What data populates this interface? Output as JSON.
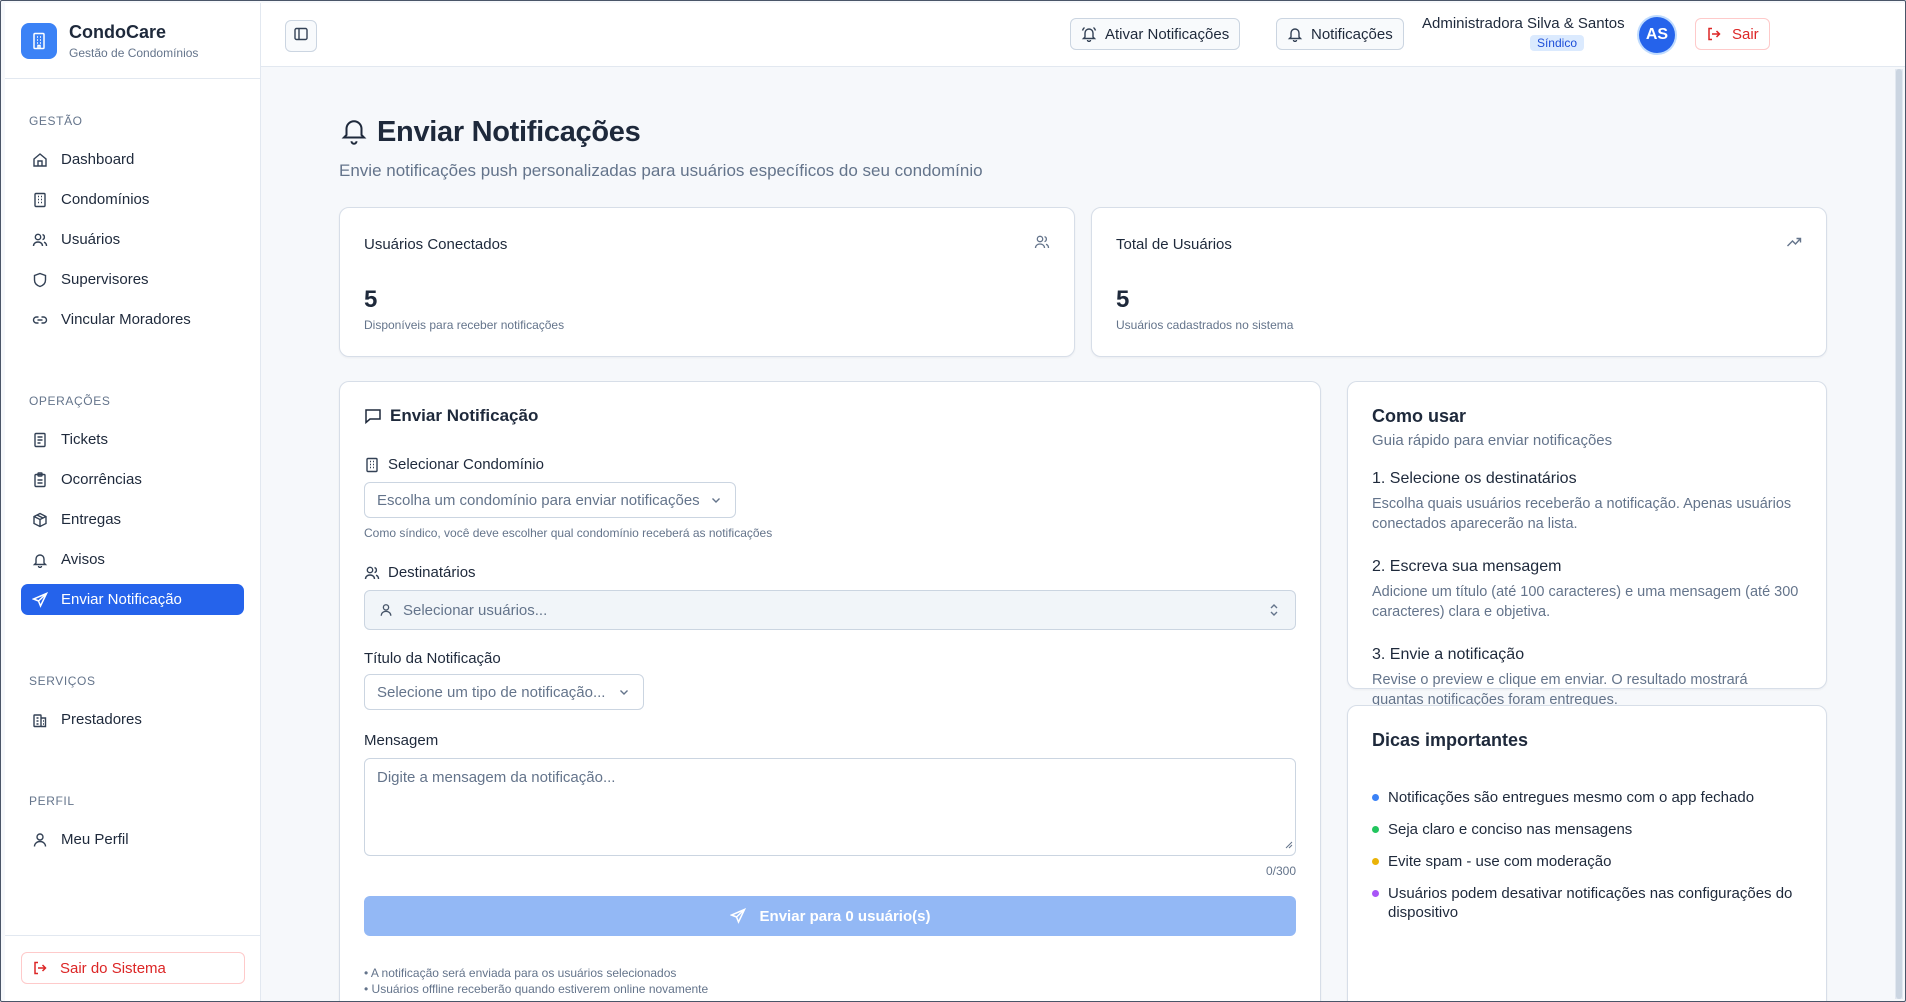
{
  "app": {
    "name": "CondoCare",
    "subtitle": "Gestão de Condomínios",
    "accent": "#2563eb"
  },
  "sidebar": {
    "sections": [
      {
        "heading": "GESTÃO",
        "items": [
          {
            "label": "Dashboard",
            "icon": "home-icon"
          },
          {
            "label": "Condomínios",
            "icon": "building-icon"
          },
          {
            "label": "Usuários",
            "icon": "users-icon"
          },
          {
            "label": "Supervisores",
            "icon": "shield-icon"
          },
          {
            "label": "Vincular Moradores",
            "icon": "link-icon"
          }
        ]
      },
      {
        "heading": "OPERAÇÕES",
        "items": [
          {
            "label": "Tickets",
            "icon": "ticket-icon"
          },
          {
            "label": "Ocorrências",
            "icon": "clipboard-icon"
          },
          {
            "label": "Entregas",
            "icon": "package-icon"
          },
          {
            "label": "Avisos",
            "icon": "bell-icon"
          },
          {
            "label": "Enviar Notificação",
            "icon": "send-icon",
            "active": true
          }
        ]
      },
      {
        "heading": "SERVIÇOS",
        "items": [
          {
            "label": "Prestadores",
            "icon": "building-2-icon"
          }
        ]
      },
      {
        "heading": "PERFIL",
        "items": [
          {
            "label": "Meu Perfil",
            "icon": "user-icon"
          }
        ]
      }
    ],
    "logout_label": "Sair do Sistema"
  },
  "topbar": {
    "enable_notifications_label": "Ativar Notificações",
    "notifications_label": "Notificações",
    "user_name": "Administradora Silva & Santos",
    "user_role": "Síndico",
    "avatar_initials": "AS",
    "logout_label": "Sair"
  },
  "page": {
    "title": "Enviar Notificações",
    "subtitle": "Envie notificações push personalizadas para usuários específicos do seu condomínio"
  },
  "stats": [
    {
      "title": "Usuários Conectados",
      "value": "5",
      "desc": "Disponíveis para receber notificações",
      "icon": "users-icon"
    },
    {
      "title": "Total de Usuários",
      "value": "5",
      "desc": "Usuários cadastrados no sistema",
      "icon": "trending-up-icon"
    }
  ],
  "form": {
    "title": "Enviar Notificação",
    "condo_label": "Selecionar Condomínio",
    "condo_placeholder": "Escolha um condomínio para enviar notificações",
    "condo_hint": "Como síndico, você deve escolher qual condomínio receberá as notificações",
    "recipients_label": "Destinatários",
    "recipients_placeholder": "Selecionar usuários...",
    "title_label": "Título da Notificação",
    "title_placeholder": "Selecione um tipo de notificação...",
    "message_label": "Mensagem",
    "message_placeholder": "Digite a mensagem da notificação...",
    "counter": "0/300",
    "send_label": "Enviar para 0 usuário(s)",
    "notes": [
      "• A notificação será enviada para os usuários selecionados",
      "• Usuários offline receberão quando estiverem online novamente"
    ]
  },
  "howto": {
    "title": "Como usar",
    "subtitle": "Guia rápido para enviar notificações",
    "steps": [
      {
        "title": "1. Selecione os destinatários",
        "desc": "Escolha quais usuários receberão a notificação. Apenas usuários conectados aparecerão na lista."
      },
      {
        "title": "2. Escreva sua mensagem",
        "desc": "Adicione um título (até 100 caracteres) e uma mensagem (até 300 caracteres) clara e objetiva."
      },
      {
        "title": "3. Envie a notificação",
        "desc": "Revise o preview e clique em enviar. O resultado mostrará quantas notificações foram entregues."
      }
    ]
  },
  "tips": {
    "title": "Dicas importantes",
    "items": [
      {
        "text": "Notificações são entregues mesmo com o app fechado",
        "color": "#3b82f6"
      },
      {
        "text": "Seja claro e conciso nas mensagens",
        "color": "#22c55e"
      },
      {
        "text": "Evite spam - use com moderação",
        "color": "#eab308"
      },
      {
        "text": "Usuários podem desativar notificações nas configurações do dispositivo",
        "color": "#a855f7"
      }
    ]
  }
}
